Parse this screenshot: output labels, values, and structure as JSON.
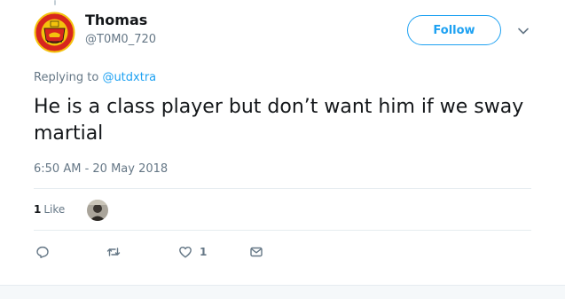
{
  "tweet": {
    "author": {
      "display_name": "Thomas",
      "handle": "@T0M0_720",
      "avatar_icon": "manchester-united-crest"
    },
    "follow_label": "Follow",
    "replying_prefix": "Replying to ",
    "replying_to": "@utdxtra",
    "text": "He is a class player but don’t want him if we sway martial",
    "timestamp": "6:50 AM - 20 May 2018",
    "like_count": "1",
    "like_word": "Like",
    "action_like_count": "1"
  },
  "colors": {
    "accent": "#1da1f2",
    "secondary_text": "#657786",
    "divider": "#e6ecf0",
    "crest_red": "#d7261e",
    "crest_yellow": "#f4c20d"
  }
}
